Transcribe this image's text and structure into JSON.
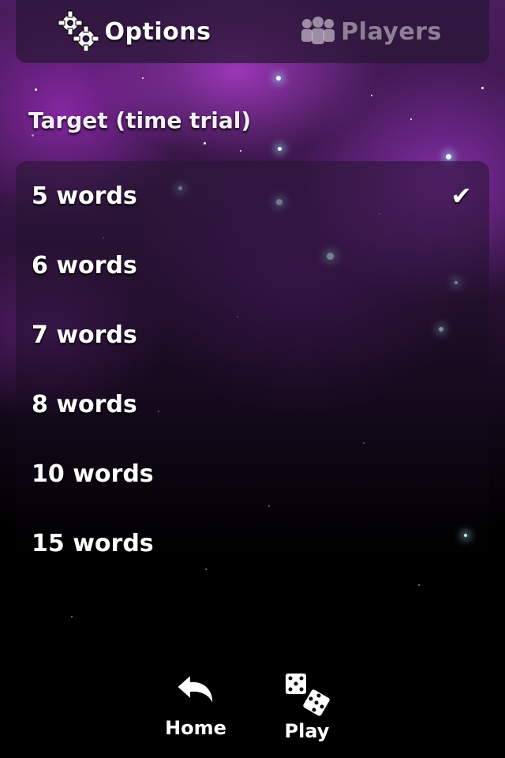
{
  "tabs": {
    "options": {
      "label": "Options",
      "icon": "gears-icon"
    },
    "players": {
      "label": "Players",
      "icon": "players-icon"
    }
  },
  "section_title": "Target (time trial)",
  "options": [
    {
      "label": "5 words",
      "selected": true
    },
    {
      "label": "6 words",
      "selected": false
    },
    {
      "label": "7 words",
      "selected": false
    },
    {
      "label": "8 words",
      "selected": false
    },
    {
      "label": "10 words",
      "selected": false
    },
    {
      "label": "15 words",
      "selected": false
    }
  ],
  "checkmark": "✔",
  "toolbar": {
    "home_label": "Home",
    "home_icon": "undo-arrow-icon",
    "play_label": "Play",
    "play_icon": "dice-icon"
  },
  "colors": {
    "nebula_purple": "#8a2ea8",
    "panel_tint": "#28163a",
    "text": "#ffffff"
  }
}
